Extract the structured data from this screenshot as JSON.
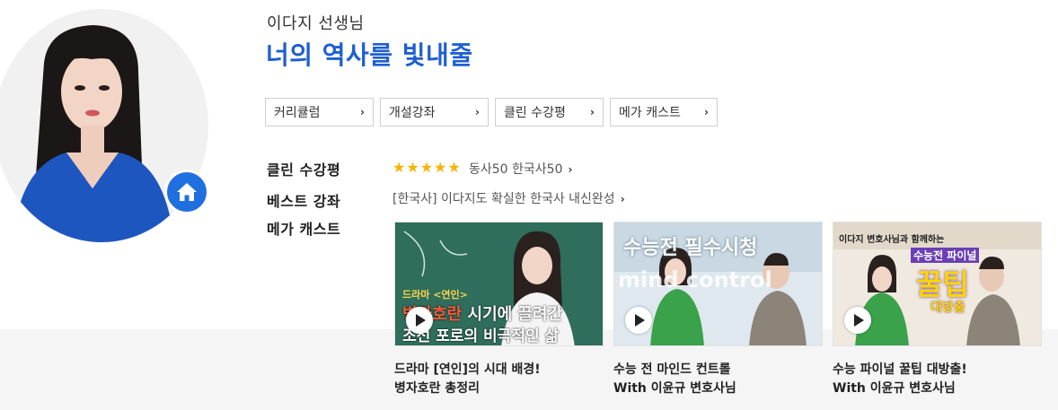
{
  "header": {
    "teacher_name": "이다지 선생님",
    "slogan": "너의 역사를 빛내줄"
  },
  "tabs": [
    {
      "label": "커리큘럼"
    },
    {
      "label": "개설강좌"
    },
    {
      "label": "클린 수강평"
    },
    {
      "label": "메가 캐스트"
    }
  ],
  "info": {
    "review_label": "클린 수강평",
    "rating_stars": 5,
    "review_text": "동사50 한국사50",
    "best_label": "베스트 강좌",
    "best_text": "[한국사] 이다지도 확실한 한국사 내신완성",
    "cast_label": "메가 캐스트"
  },
  "videos": [
    {
      "thumb_tag": "드라마 <연인>",
      "thumb_line1_highlight": "병자호란",
      "thumb_line1_rest": " 시기에 끌려간",
      "thumb_line2": "조선 포로의 비극적인 삶",
      "caption_line1": "드라마 [연인]의 시대 배경!",
      "caption_line2": "병자호란 총정리"
    },
    {
      "thumb_title": "수능전 필수시청",
      "thumb_subtitle": "mind control",
      "caption_line1": "수능 전 마인드 컨트롤",
      "caption_line2": "With 이윤규 변호사님"
    },
    {
      "thumb_top": "이다지 변호사님과 함께하는",
      "thumb_mid": "수능전 파이널",
      "thumb_big": "꿀팁",
      "thumb_small": "대방출",
      "caption_line1": "수능 파이널 꿀팁 대방출!",
      "caption_line2": "With 이윤규 변호사님"
    }
  ],
  "icons": {
    "home": "home-icon",
    "chevron": "chevron-right-icon",
    "play": "play-icon",
    "star": "star-icon"
  },
  "colors": {
    "accent": "#1f5fd1",
    "home_button": "#1f6fe0",
    "star": "#f5b400"
  }
}
